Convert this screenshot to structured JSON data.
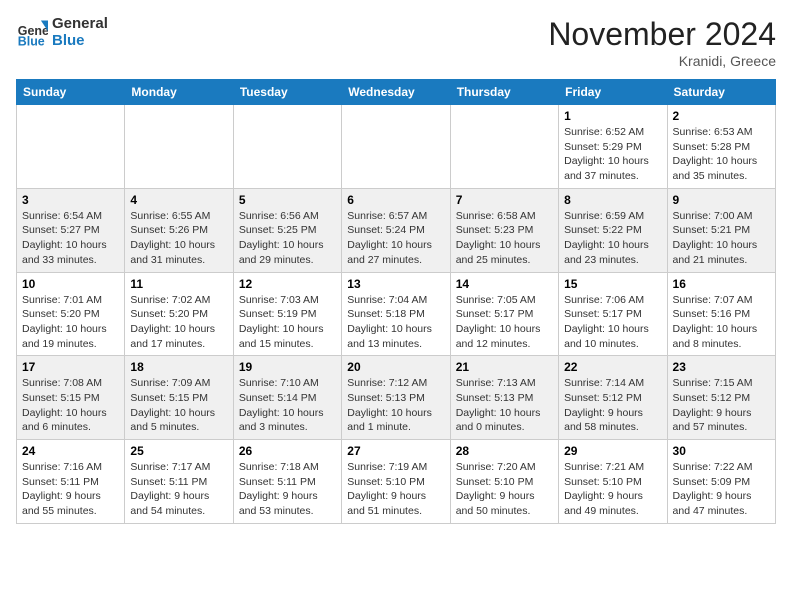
{
  "header": {
    "logo_general": "General",
    "logo_blue": "Blue",
    "month_title": "November 2024",
    "subtitle": "Kranidi, Greece"
  },
  "days_of_week": [
    "Sunday",
    "Monday",
    "Tuesday",
    "Wednesday",
    "Thursday",
    "Friday",
    "Saturday"
  ],
  "weeks": [
    [
      {
        "day": "",
        "info": ""
      },
      {
        "day": "",
        "info": ""
      },
      {
        "day": "",
        "info": ""
      },
      {
        "day": "",
        "info": ""
      },
      {
        "day": "",
        "info": ""
      },
      {
        "day": "1",
        "info": "Sunrise: 6:52 AM\nSunset: 5:29 PM\nDaylight: 10 hours and 37 minutes."
      },
      {
        "day": "2",
        "info": "Sunrise: 6:53 AM\nSunset: 5:28 PM\nDaylight: 10 hours and 35 minutes."
      }
    ],
    [
      {
        "day": "3",
        "info": "Sunrise: 6:54 AM\nSunset: 5:27 PM\nDaylight: 10 hours and 33 minutes."
      },
      {
        "day": "4",
        "info": "Sunrise: 6:55 AM\nSunset: 5:26 PM\nDaylight: 10 hours and 31 minutes."
      },
      {
        "day": "5",
        "info": "Sunrise: 6:56 AM\nSunset: 5:25 PM\nDaylight: 10 hours and 29 minutes."
      },
      {
        "day": "6",
        "info": "Sunrise: 6:57 AM\nSunset: 5:24 PM\nDaylight: 10 hours and 27 minutes."
      },
      {
        "day": "7",
        "info": "Sunrise: 6:58 AM\nSunset: 5:23 PM\nDaylight: 10 hours and 25 minutes."
      },
      {
        "day": "8",
        "info": "Sunrise: 6:59 AM\nSunset: 5:22 PM\nDaylight: 10 hours and 23 minutes."
      },
      {
        "day": "9",
        "info": "Sunrise: 7:00 AM\nSunset: 5:21 PM\nDaylight: 10 hours and 21 minutes."
      }
    ],
    [
      {
        "day": "10",
        "info": "Sunrise: 7:01 AM\nSunset: 5:20 PM\nDaylight: 10 hours and 19 minutes."
      },
      {
        "day": "11",
        "info": "Sunrise: 7:02 AM\nSunset: 5:20 PM\nDaylight: 10 hours and 17 minutes."
      },
      {
        "day": "12",
        "info": "Sunrise: 7:03 AM\nSunset: 5:19 PM\nDaylight: 10 hours and 15 minutes."
      },
      {
        "day": "13",
        "info": "Sunrise: 7:04 AM\nSunset: 5:18 PM\nDaylight: 10 hours and 13 minutes."
      },
      {
        "day": "14",
        "info": "Sunrise: 7:05 AM\nSunset: 5:17 PM\nDaylight: 10 hours and 12 minutes."
      },
      {
        "day": "15",
        "info": "Sunrise: 7:06 AM\nSunset: 5:17 PM\nDaylight: 10 hours and 10 minutes."
      },
      {
        "day": "16",
        "info": "Sunrise: 7:07 AM\nSunset: 5:16 PM\nDaylight: 10 hours and 8 minutes."
      }
    ],
    [
      {
        "day": "17",
        "info": "Sunrise: 7:08 AM\nSunset: 5:15 PM\nDaylight: 10 hours and 6 minutes."
      },
      {
        "day": "18",
        "info": "Sunrise: 7:09 AM\nSunset: 5:15 PM\nDaylight: 10 hours and 5 minutes."
      },
      {
        "day": "19",
        "info": "Sunrise: 7:10 AM\nSunset: 5:14 PM\nDaylight: 10 hours and 3 minutes."
      },
      {
        "day": "20",
        "info": "Sunrise: 7:12 AM\nSunset: 5:13 PM\nDaylight: 10 hours and 1 minute."
      },
      {
        "day": "21",
        "info": "Sunrise: 7:13 AM\nSunset: 5:13 PM\nDaylight: 10 hours and 0 minutes."
      },
      {
        "day": "22",
        "info": "Sunrise: 7:14 AM\nSunset: 5:12 PM\nDaylight: 9 hours and 58 minutes."
      },
      {
        "day": "23",
        "info": "Sunrise: 7:15 AM\nSunset: 5:12 PM\nDaylight: 9 hours and 57 minutes."
      }
    ],
    [
      {
        "day": "24",
        "info": "Sunrise: 7:16 AM\nSunset: 5:11 PM\nDaylight: 9 hours and 55 minutes."
      },
      {
        "day": "25",
        "info": "Sunrise: 7:17 AM\nSunset: 5:11 PM\nDaylight: 9 hours and 54 minutes."
      },
      {
        "day": "26",
        "info": "Sunrise: 7:18 AM\nSunset: 5:11 PM\nDaylight: 9 hours and 53 minutes."
      },
      {
        "day": "27",
        "info": "Sunrise: 7:19 AM\nSunset: 5:10 PM\nDaylight: 9 hours and 51 minutes."
      },
      {
        "day": "28",
        "info": "Sunrise: 7:20 AM\nSunset: 5:10 PM\nDaylight: 9 hours and 50 minutes."
      },
      {
        "day": "29",
        "info": "Sunrise: 7:21 AM\nSunset: 5:10 PM\nDaylight: 9 hours and 49 minutes."
      },
      {
        "day": "30",
        "info": "Sunrise: 7:22 AM\nSunset: 5:09 PM\nDaylight: 9 hours and 47 minutes."
      }
    ]
  ]
}
